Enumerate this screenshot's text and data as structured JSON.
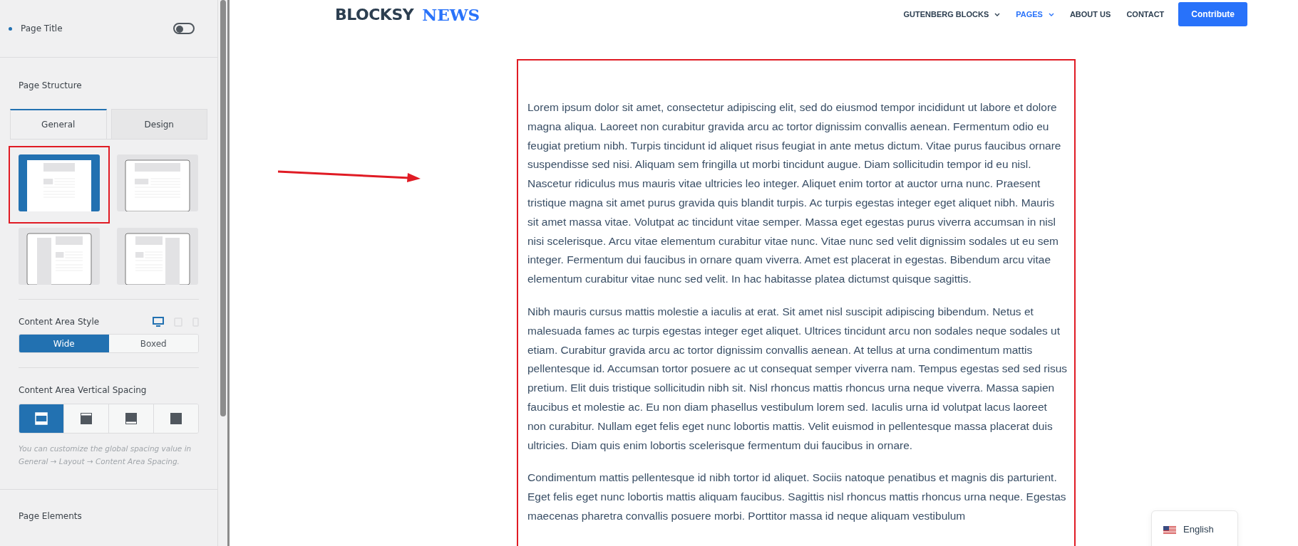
{
  "sidebar": {
    "page_title": {
      "label": "Page Title",
      "on": false
    },
    "page_structure": {
      "title": "Page Structure",
      "tabs": [
        {
          "label": "General",
          "selected": true
        },
        {
          "label": "Design",
          "selected": false
        }
      ],
      "layouts": [
        {
          "kind": "centered",
          "selected": true,
          "highlighted": true
        },
        {
          "kind": "narrow",
          "selected": false,
          "highlighted": false
        },
        {
          "kind": "left-sidebar",
          "selected": false,
          "highlighted": false
        },
        {
          "kind": "right-sidebar",
          "selected": false,
          "highlighted": false
        }
      ]
    },
    "content_area_style": {
      "label": "Content Area Style",
      "devices": [
        {
          "kind": "desktop",
          "selected": true
        },
        {
          "kind": "tablet",
          "selected": false
        },
        {
          "kind": "mobile",
          "selected": false
        }
      ],
      "options": [
        {
          "label": "Wide",
          "selected": true
        },
        {
          "label": "Boxed",
          "selected": false
        }
      ]
    },
    "vertical_spacing": {
      "label": "Content Area Vertical Spacing",
      "options": [
        {
          "kind": "both",
          "selected": true
        },
        {
          "kind": "top",
          "selected": false
        },
        {
          "kind": "bottom",
          "selected": false
        },
        {
          "kind": "none",
          "selected": false
        }
      ],
      "hint": "You can customize the global spacing value in General → Layout → Content Area Spacing."
    },
    "next_section": "Page Elements"
  },
  "site": {
    "logo": [
      "BLOCKSY",
      "NEWS"
    ],
    "nav": [
      {
        "label": "GUTENBERG BLOCKS",
        "dropdown": true,
        "selected": false
      },
      {
        "label": "PAGES",
        "dropdown": true,
        "selected": true
      },
      {
        "label": "ABOUT US",
        "dropdown": false,
        "selected": false
      },
      {
        "label": "CONTACT",
        "dropdown": false,
        "selected": false
      }
    ],
    "button": "Contribute",
    "paragraphs": [
      "Lorem ipsum dolor sit amet, consectetur adipiscing elit, sed do eiusmod tempor incididunt ut labore et dolore magna aliqua. Laoreet non curabitur gravida arcu ac tortor dignissim convallis aenean. Fermentum odio eu feugiat pretium nibh. Turpis tincidunt id aliquet risus feugiat in ante metus dictum. Vitae purus faucibus ornare suspendisse sed nisi. Aliquam sem fringilla ut morbi tincidunt augue. Diam sollicitudin tempor id eu nisl. Nascetur ridiculus mus mauris vitae ultricies leo integer. Aliquet enim tortor at auctor urna nunc. Praesent tristique magna sit amet purus gravida quis blandit turpis. Ac turpis egestas integer eget aliquet nibh. Mauris sit amet massa vitae. Volutpat ac tincidunt vitae semper. Massa eget egestas purus viverra accumsan in nisl nisi scelerisque. Arcu vitae elementum curabitur vitae nunc. Vitae nunc sed velit dignissim sodales ut eu sem integer. Fermentum dui faucibus in ornare quam viverra. Amet est placerat in egestas. Bibendum arcu vitae elementum curabitur vitae nunc sed velit. In hac habitasse platea dictumst quisque sagittis.",
      "Nibh mauris cursus mattis molestie a iaculis at erat. Sit amet nisl suscipit adipiscing bibendum. Netus et malesuada fames ac turpis egestas integer eget aliquet. Ultrices tincidunt arcu non sodales neque sodales ut etiam. Curabitur gravida arcu ac tortor dignissim convallis aenean. At tellus at urna condimentum mattis pellentesque id. Accumsan tortor posuere ac ut consequat semper viverra nam. Tempus egestas sed sed risus pretium. Elit duis tristique sollicitudin nibh sit. Nisl rhoncus mattis rhoncus urna neque viverra. Massa sapien faucibus et molestie ac. Eu non diam phasellus vestibulum lorem sed. Iaculis urna id volutpat lacus laoreet non curabitur. Nullam eget felis eget nunc lobortis mattis. Velit euismod in pellentesque massa placerat duis ultricies. Diam quis enim lobortis scelerisque fermentum dui faucibus in ornare.",
      "Condimentum mattis pellentesque id nibh tortor id aliquet. Sociis natoque penatibus et magnis dis parturient. Eget felis eget nunc lobortis mattis aliquam faucibus. Sagittis nisl rhoncus mattis rhoncus urna neque. Egestas maecenas pharetra convallis posuere morbi. Porttitor massa id neque aliquam vestibulum"
    ],
    "language": "English"
  }
}
